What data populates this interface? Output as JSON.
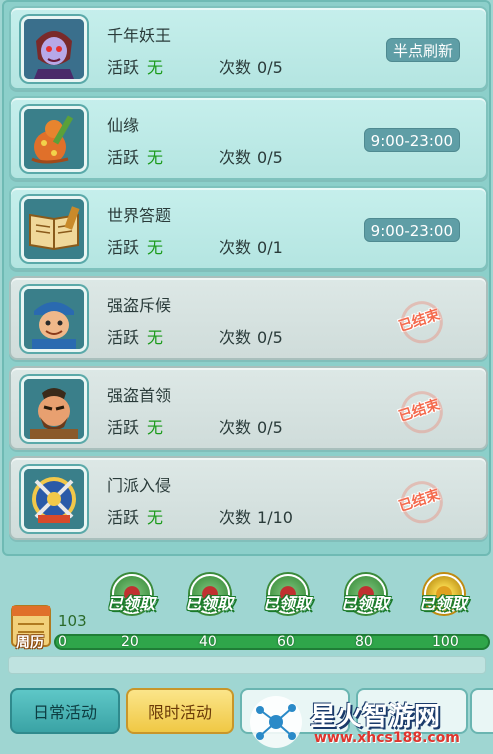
{
  "activities": [
    {
      "title": "千年妖王",
      "active_label": "活跃",
      "active_value": "无",
      "count_label": "次数",
      "count_value": "0/5",
      "status": "time",
      "time": "半点刷新",
      "icon": "demon-king-icon"
    },
    {
      "title": "仙缘",
      "active_label": "活跃",
      "active_value": "无",
      "count_label": "次数",
      "count_value": "0/5",
      "status": "time",
      "time": "9:00-23:00",
      "icon": "gourd-icon"
    },
    {
      "title": "世界答题",
      "active_label": "活跃",
      "active_value": "无",
      "count_label": "次数",
      "count_value": "0/1",
      "status": "time",
      "time": "9:00-23:00",
      "icon": "book-icon"
    },
    {
      "title": "强盗斥候",
      "active_label": "活跃",
      "active_value": "无",
      "count_label": "次数",
      "count_value": "0/5",
      "status": "ended",
      "ended_label": "已结束",
      "icon": "bandit-scout-icon"
    },
    {
      "title": "强盗首领",
      "active_label": "活跃",
      "active_value": "无",
      "count_label": "次数",
      "count_value": "0/5",
      "status": "ended",
      "ended_label": "已结束",
      "icon": "bandit-leader-icon"
    },
    {
      "title": "门派入侵",
      "active_label": "活跃",
      "active_value": "无",
      "count_label": "次数",
      "count_value": "1/10",
      "status": "ended",
      "ended_label": "已结束",
      "icon": "sect-shield-icon"
    }
  ],
  "progress": {
    "calendar_label": "周历",
    "total": "103",
    "ticks": [
      "0",
      "20",
      "40",
      "60",
      "80",
      "100"
    ],
    "rewards": [
      {
        "label": "已领取",
        "style": "green"
      },
      {
        "label": "已领取",
        "style": "green"
      },
      {
        "label": "已领取",
        "style": "green"
      },
      {
        "label": "已领取",
        "style": "green"
      },
      {
        "label": "已领取",
        "style": "gold"
      }
    ]
  },
  "tabs": {
    "daily": "日常活动",
    "timed": "限时活动"
  },
  "watermark": {
    "name": "星火智游网",
    "url": "www.xhcs188.com"
  },
  "colors": {
    "active_value": "#1a9a1a",
    "badge_bg": "#5f9ea6",
    "ended_stamp": "#f46a4d",
    "progress_fill": "#2fa64a"
  }
}
